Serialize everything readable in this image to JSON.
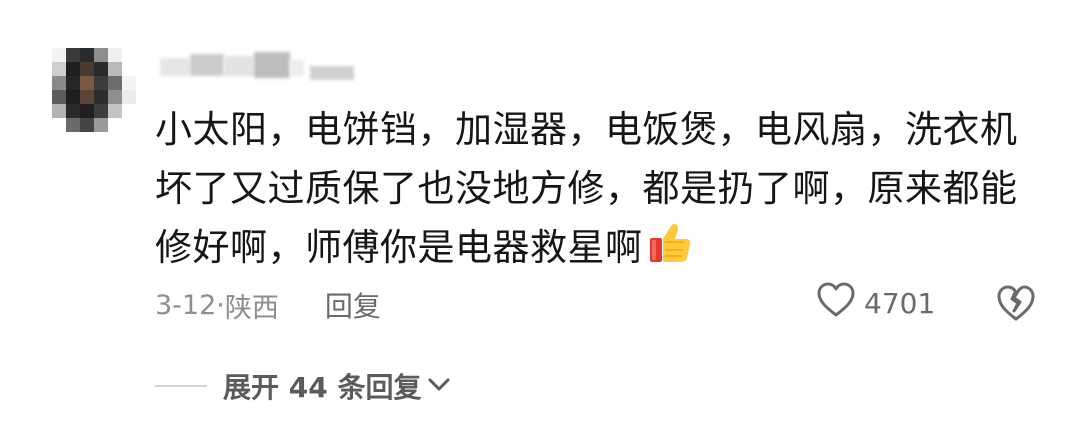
{
  "comment": {
    "lines": [
      "小太阳，电饼铛，加湿器，电饭煲，电风扇，洗衣机",
      "坏了又过质保了也没地方修，都是扔了啊，原来都能",
      "修好啊，师傅你是电器救星啊"
    ],
    "emoji": "thumbs-up",
    "date": "3-12",
    "separator": "·",
    "location": "陕西",
    "reply_label": "回复",
    "like_count": "4701"
  },
  "replies": {
    "expand_label": "展开 44 条回复"
  },
  "colors": {
    "text": "#161616",
    "meta": "#8e8e8e",
    "icon": "#6a6a6a"
  }
}
